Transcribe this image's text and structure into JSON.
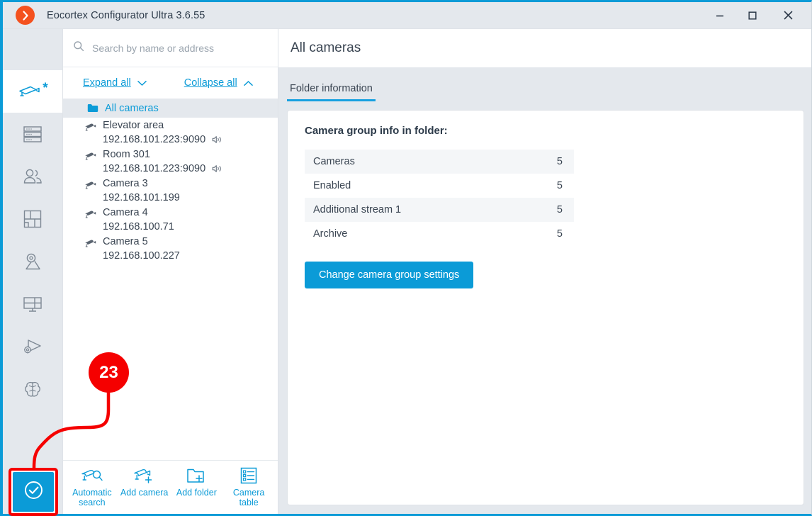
{
  "window": {
    "title": "Eocortex Configurator Ultra 3.6.55",
    "logo_icon": "orange-chevron-logo",
    "controls": {
      "minimize": "minimize-icon",
      "maximize": "maximize-icon",
      "close": "close-icon"
    },
    "accent_color": "#0b9bd7",
    "titlebar_color": "#e4e8ed",
    "logo_color": "#f4511e"
  },
  "rail": {
    "items": [
      {
        "icon": "camera-icon",
        "active": true,
        "badge": "*"
      },
      {
        "icon": "servers-icon",
        "active": false
      },
      {
        "icon": "users-icon",
        "active": false
      },
      {
        "icon": "floorplan-icon",
        "active": false
      },
      {
        "icon": "map-pin-icon",
        "active": false
      },
      {
        "icon": "layouts-icon",
        "active": false
      },
      {
        "icon": "automation-icon",
        "active": false
      },
      {
        "icon": "neural-network-icon",
        "active": false
      }
    ]
  },
  "tree": {
    "search": {
      "placeholder": "Search by name or address",
      "value": "",
      "icon": "search-icon"
    },
    "expand_all": "Expand all",
    "collapse_all": "Collapse all",
    "root": {
      "label": "All cameras",
      "icon": "folder-icon",
      "selected": true
    },
    "cameras": [
      {
        "name": "Elevator area",
        "address": "192.168.101.223:9090",
        "audio": true
      },
      {
        "name": "Room 301",
        "address": "192.168.101.223:9090",
        "audio": true
      },
      {
        "name": "Camera 3",
        "address": "192.168.101.199",
        "audio": false
      },
      {
        "name": "Camera 4",
        "address": "192.168.100.71",
        "audio": false
      },
      {
        "name": "Camera 5",
        "address": "192.168.100.227",
        "audio": false
      }
    ],
    "toolbar": [
      {
        "label": "Automatic search",
        "icon": "camera-search-icon"
      },
      {
        "label": "Add camera",
        "icon": "camera-plus-icon"
      },
      {
        "label": "Add folder",
        "icon": "folder-plus-icon"
      },
      {
        "label": "Camera table",
        "icon": "table-list-icon"
      }
    ]
  },
  "content": {
    "page_title": "All cameras",
    "tabs": [
      {
        "label": "Folder information",
        "active": true
      }
    ],
    "card": {
      "title": "Camera group info in folder:",
      "rows": [
        {
          "label": "Cameras",
          "value": "5"
        },
        {
          "label": "Enabled",
          "value": "5"
        },
        {
          "label": "Additional stream 1",
          "value": "5"
        },
        {
          "label": "Archive",
          "value": "5"
        }
      ],
      "action_button": "Change camera group settings"
    }
  },
  "annotation": {
    "number": "23",
    "badge_color": "#f50000",
    "target_icon": "check-circle-icon"
  }
}
